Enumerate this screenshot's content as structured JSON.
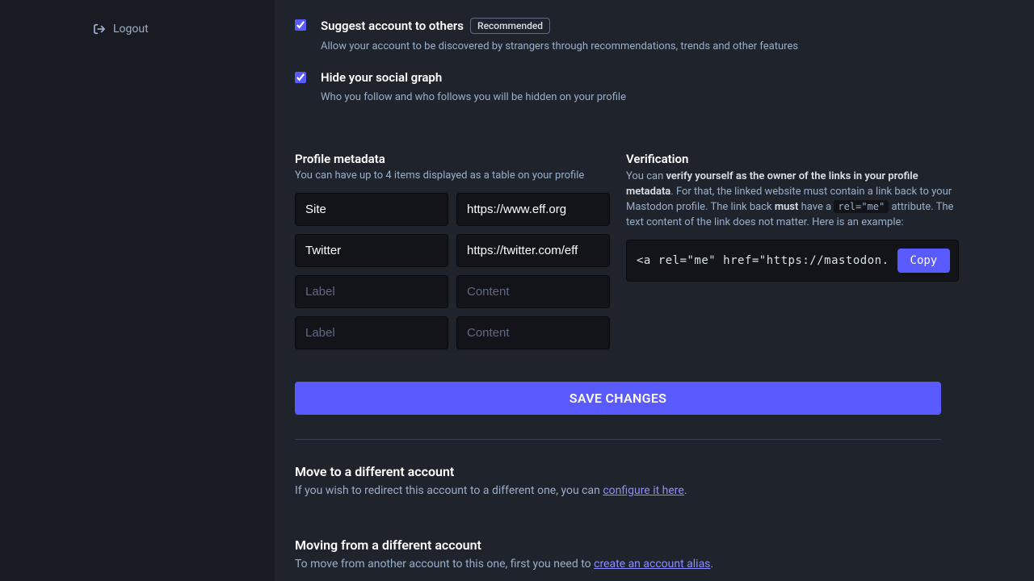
{
  "sidebar": {
    "logout": "Logout"
  },
  "suggest": {
    "label": "Suggest account to others",
    "badge": "Recommended",
    "hint": "Allow your account to be discovered by strangers through recommendations, trends and other features"
  },
  "hideGraph": {
    "label": "Hide your social graph",
    "hint": "Who you follow and who follows you will be hidden on your profile"
  },
  "metadata": {
    "title": "Profile metadata",
    "hint": "You can have up to 4 items displayed as a table on your profile",
    "rows": [
      {
        "label": "Site",
        "content": "https://www.eff.org"
      },
      {
        "label": "Twitter",
        "content": "https://twitter.com/eff"
      },
      {
        "label": "",
        "content": ""
      },
      {
        "label": "",
        "content": ""
      }
    ],
    "labelPlaceholder": "Label",
    "contentPlaceholder": "Content"
  },
  "verification": {
    "title": "Verification",
    "text_prefix": "You can ",
    "text_bold1": "verify yourself as the owner of the links in your profile metadata",
    "text_mid1": ". For that, the linked website must contain a link back to your Mastodon profile. The link back ",
    "text_bold2": "must",
    "text_mid2": " have a ",
    "text_code": "rel=\"me\"",
    "text_suffix": " attribute. The text content of the link does not matter. Here is an example:",
    "snippet": "<a rel=\"me\" href=\"https://mastodon.",
    "copy": "Copy"
  },
  "save": "SAVE CHANGES",
  "move": {
    "title": "Move to a different account",
    "text_prefix": "If you wish to redirect this account to a different one, you can ",
    "link": "configure it here",
    "text_suffix": "."
  },
  "movingFrom": {
    "title": "Moving from a different account",
    "text_prefix": "To move from another account to this one, first you need to ",
    "link": "create an account alias",
    "text_suffix": "."
  }
}
